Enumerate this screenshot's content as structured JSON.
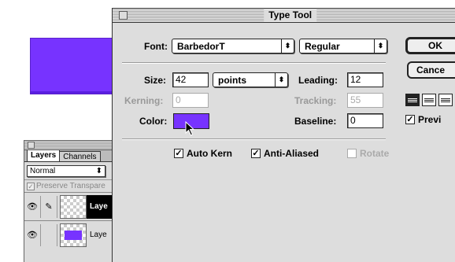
{
  "colors": {
    "swatch": "#7733ff"
  },
  "layers_palette": {
    "tabs": [
      "Layers",
      "Channels"
    ],
    "blend_mode": "Normal",
    "preserve_label": "Preserve Transpare",
    "layers": [
      {
        "name": "Laye",
        "selected": true
      },
      {
        "name": "Laye",
        "selected": false
      }
    ]
  },
  "dialog": {
    "title": "Type Tool",
    "font_label": "Font:",
    "font_value": "BarbedorT",
    "style_value": "Regular",
    "size_label": "Size:",
    "size_value": "42",
    "units_value": "points",
    "leading_label": "Leading:",
    "leading_value": "12",
    "kerning_label": "Kerning:",
    "kerning_value": "0",
    "tracking_label": "Tracking:",
    "tracking_value": "55",
    "color_label": "Color:",
    "baseline_label": "Baseline:",
    "baseline_value": "0",
    "ok_label": "OK",
    "cancel_label": "Cance",
    "preview_label": "Previ",
    "auto_kern_label": "Auto Kern",
    "anti_aliased_label": "Anti-Aliased",
    "rotate_label": "Rotate"
  }
}
